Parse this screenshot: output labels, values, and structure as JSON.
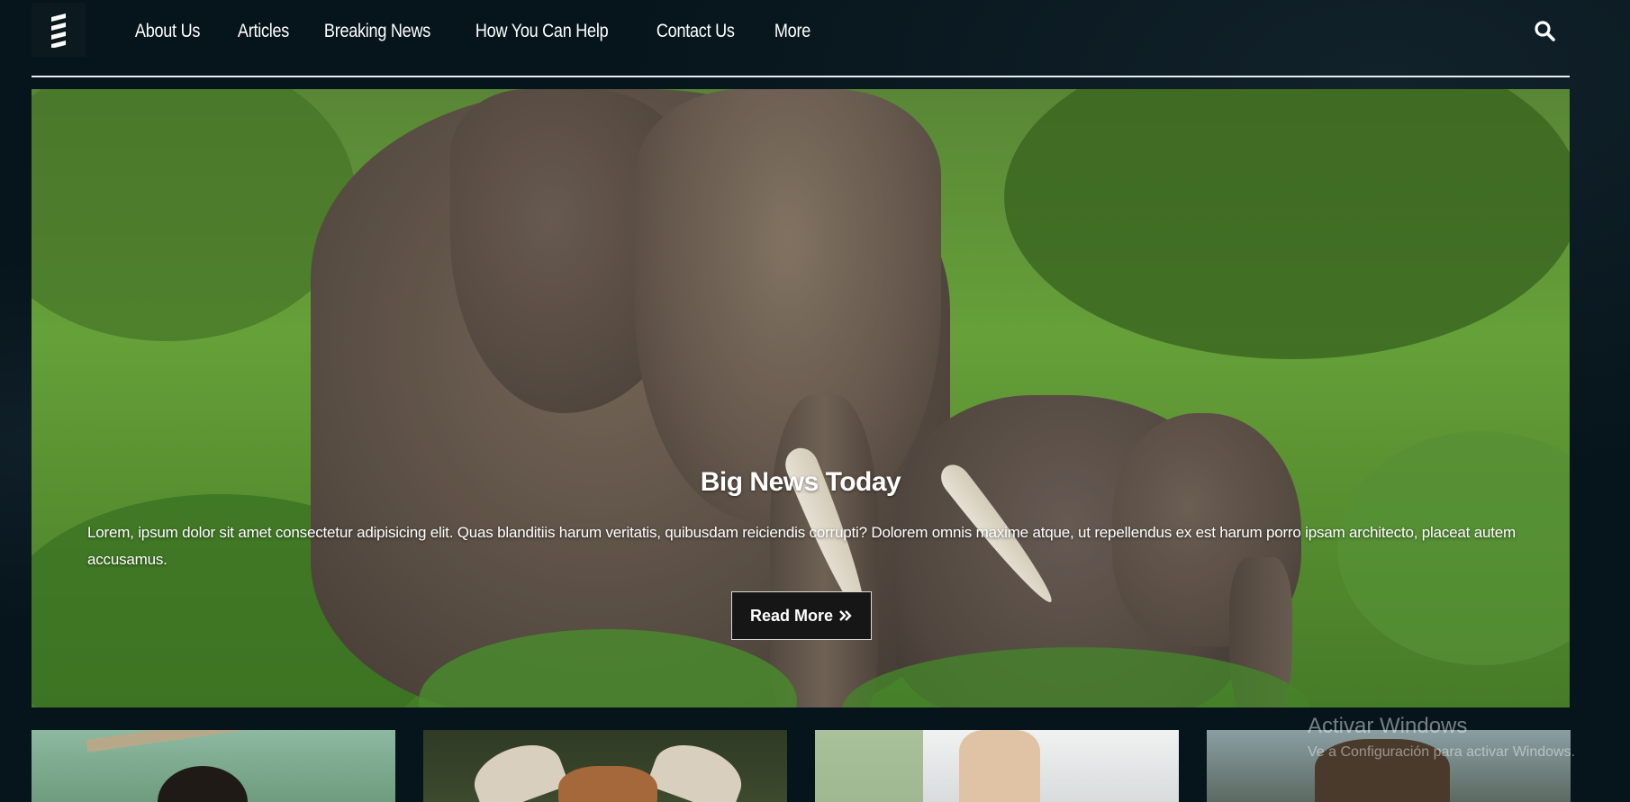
{
  "site": {
    "logo_icon": "zigzag-logo-icon"
  },
  "nav": {
    "items": [
      {
        "label": "About Us"
      },
      {
        "label": "Articles"
      },
      {
        "label": "Breaking News"
      },
      {
        "label": "How You Can Help"
      },
      {
        "label": "Contact Us"
      },
      {
        "label": "More"
      }
    ],
    "search_icon": "search-icon"
  },
  "hero": {
    "title": "Big News Today",
    "text": "Lorem, ipsum dolor sit amet consectetur adipisicing elit. Quas blanditiis harum veritatis, quibusdam reiciendis corrupti? Dolorem omnis maxime atque, ut repellendus ex est harum porro ipsam architecto, placeat autem accusamus.",
    "button_label": "Read More",
    "button_icon": "double-chevron-right-icon"
  },
  "cards": [
    {
      "image": "monkey-on-rope"
    },
    {
      "image": "deer-ears"
    },
    {
      "image": "giraffe"
    },
    {
      "image": "horse"
    }
  ],
  "watermark": {
    "title": "Activar Windows",
    "subtitle": "Ve a Configuración para activar Windows."
  },
  "colors": {
    "background": "#06141b",
    "accent": "#ffffff",
    "button_bg": "#161616"
  }
}
